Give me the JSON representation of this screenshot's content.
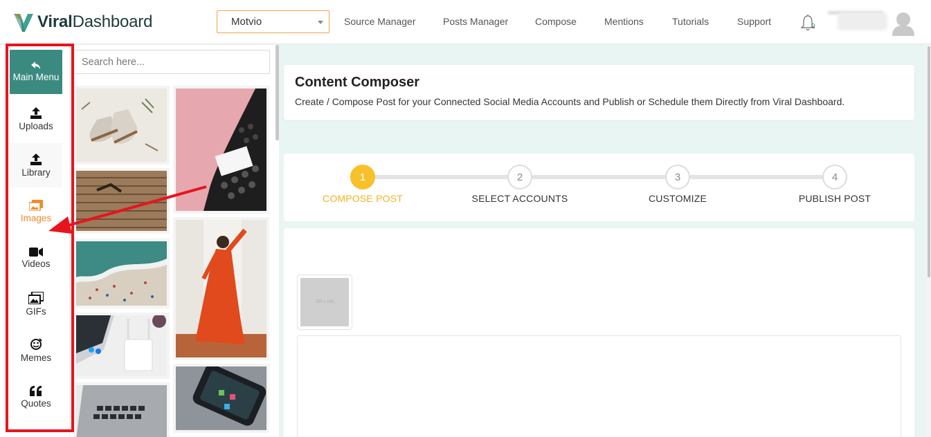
{
  "brand": {
    "name_bold": "Viral",
    "name_thin": "Dashboard"
  },
  "header": {
    "workspace_selected": "Motvio",
    "nav": [
      "Source Manager",
      "Posts Manager",
      "Compose",
      "Mentions",
      "Tutorials",
      "Support"
    ],
    "notification_count": "0"
  },
  "sidebar": {
    "items": [
      {
        "label": "Main Menu",
        "icon": "back-arrow-icon"
      },
      {
        "label": "Uploads",
        "icon": "upload-icon"
      },
      {
        "label": "Library",
        "icon": "upload-icon"
      },
      {
        "label": "Images",
        "icon": "images-icon"
      },
      {
        "label": "Videos",
        "icon": "video-camera-icon"
      },
      {
        "label": "GIFs",
        "icon": "gif-icon"
      },
      {
        "label": "Memes",
        "icon": "meme-icon"
      },
      {
        "label": "Quotes",
        "icon": "quote-icon"
      }
    ]
  },
  "media": {
    "search_placeholder": "Search here..."
  },
  "composer": {
    "title": "Content Composer",
    "subtitle": "Create / Compose Post for your Connected Social Media Accounts and Publish or Schedule them Directly from Viral Dashboard.",
    "steps": [
      {
        "num": "1",
        "label": "COMPOSE POST"
      },
      {
        "num": "2",
        "label": "SELECT ACCOUNTS"
      },
      {
        "num": "3",
        "label": "CUSTOMIZE"
      },
      {
        "num": "4",
        "label": "PUBLISH POST"
      }
    ],
    "active_step": 1,
    "placeholder_label": "150 x 150"
  },
  "colors": {
    "accent": "#3a8a80",
    "active_step": "#f8c02b",
    "images_active": "#f08a2a",
    "highlight": "#e8141d"
  }
}
